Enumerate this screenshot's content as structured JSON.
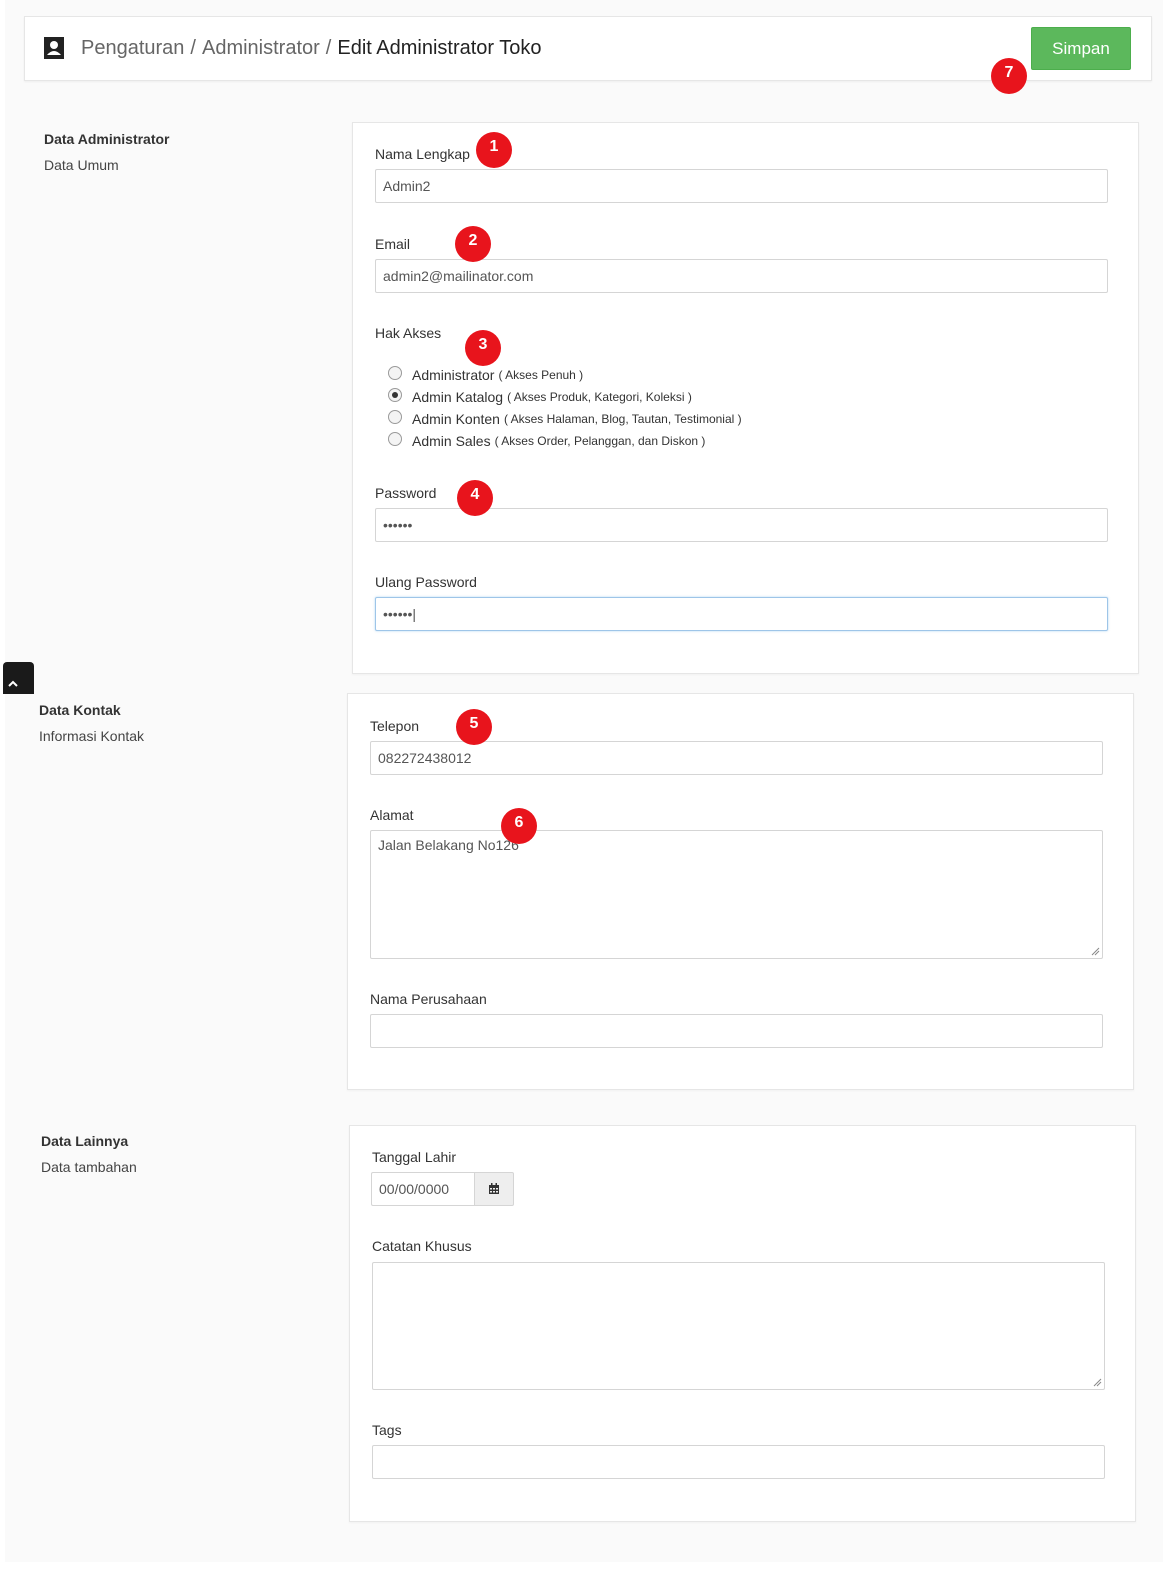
{
  "header": {
    "breadcrumb": [
      "Pengaturan",
      "Administrator"
    ],
    "separator": "/",
    "current": "Edit Administrator Toko",
    "save_label": "Simpan"
  },
  "annotations": [
    "1",
    "2",
    "3",
    "4",
    "5",
    "6",
    "7"
  ],
  "sections": {
    "admin": {
      "title": "Data Administrator",
      "subtitle": "Data Umum",
      "nama_label": "Nama Lengkap",
      "nama_value": "Admin2",
      "email_label": "Email",
      "email_value": "admin2@mailinator.com",
      "hak_akses_label": "Hak Akses",
      "roles": [
        {
          "name": "Administrator",
          "desc": "( Akses Penuh )",
          "checked": false
        },
        {
          "name": "Admin Katalog",
          "desc": "( Akses Produk, Kategori, Koleksi )",
          "checked": true
        },
        {
          "name": "Admin Konten",
          "desc": "( Akses Halaman, Blog, Tautan, Testimonial )",
          "checked": false
        },
        {
          "name": "Admin Sales",
          "desc": "( Akses Order, Pelanggan, dan Diskon )",
          "checked": false
        }
      ],
      "password_label": "Password",
      "password_value": "••••••",
      "ulang_password_label": "Ulang Password",
      "ulang_password_value": "••••••|"
    },
    "kontak": {
      "title": "Data Kontak",
      "subtitle": "Informasi Kontak",
      "telepon_label": "Telepon",
      "telepon_value": "082272438012",
      "alamat_label": "Alamat",
      "alamat_value": "Jalan Belakang No126",
      "perusahaan_label": "Nama Perusahaan",
      "perusahaan_value": ""
    },
    "lainnya": {
      "title": "Data Lainnya",
      "subtitle": "Data tambahan",
      "tanggal_label": "Tanggal Lahir",
      "tanggal_value": "00/00/0000",
      "catatan_label": "Catatan Khusus",
      "catatan_value": "",
      "tags_label": "Tags",
      "tags_value": ""
    }
  },
  "colors": {
    "save_button": "#5cb85c",
    "badge": "#e8141c",
    "page_background": "#fafafa"
  },
  "icons": {
    "title": "contact-card-icon",
    "calendar": "calendar-icon",
    "back_to_top": "chevron-up-icon"
  }
}
